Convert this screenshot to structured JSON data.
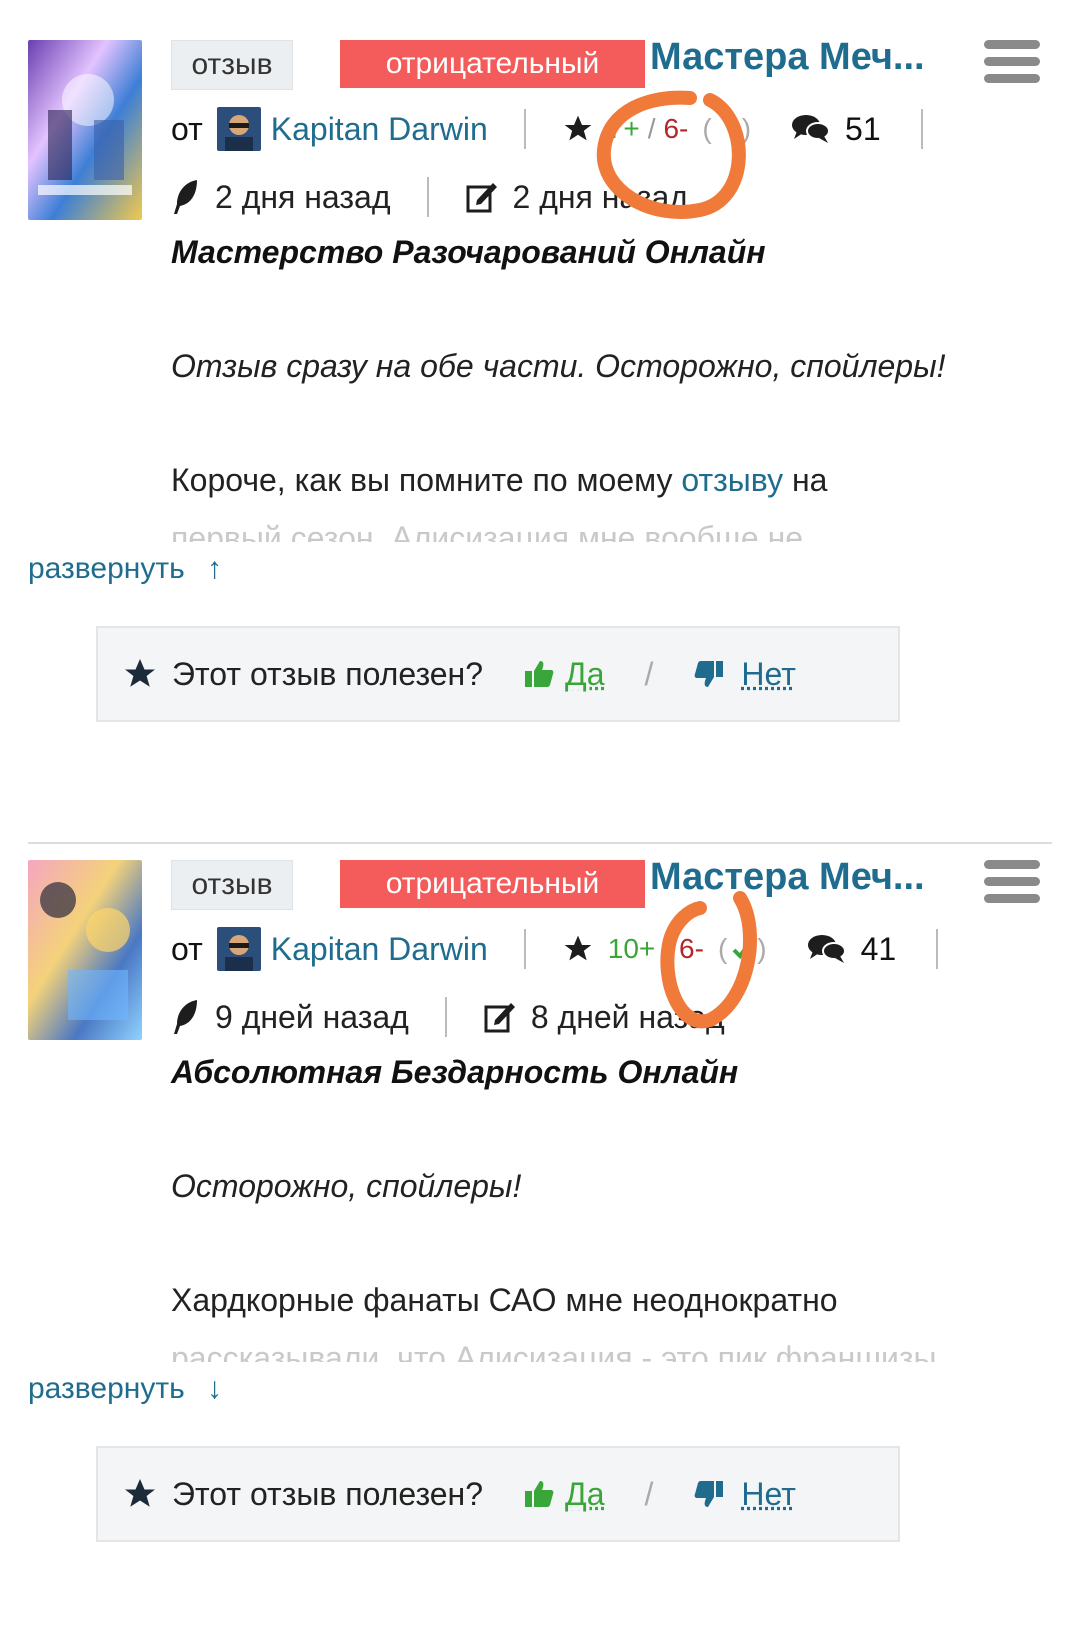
{
  "reviews": [
    {
      "type_label": "отзыв",
      "sentiment_label": "отрицательный",
      "anime_title": "Мастера Меч...",
      "by_label": "от",
      "author": "Kapitan Darwin",
      "rating_plus": "7+",
      "rating_minus": "6-",
      "rating_extra_open": "(",
      "rating_extra_close": ")",
      "comments": "51",
      "posted": "2 дня назад",
      "edited": "2 дня назад",
      "heading": "Мастерство Разочарований Онлайн",
      "intro": "Отзыв сразу на обе части. Осторожно, спойлеры!",
      "text_before_link": "Короче, как вы помните по моему ",
      "text_link": "отзыву",
      "text_after_link": " на",
      "faded_line": "первый сезон, Алисизация мне вообще не",
      "expand_label": "развернуть",
      "expand_arrow": "↑",
      "helpful_question": "Этот отзыв полезен?",
      "yes_label": "Да",
      "separator": "/",
      "no_label": "Нет"
    },
    {
      "type_label": "отзыв",
      "sentiment_label": "отрицательный",
      "anime_title": "Мастера Меч...",
      "by_label": "от",
      "author": "Kapitan Darwin",
      "rating_plus": "10+",
      "rating_minus": "6-",
      "rating_extra_open": "(",
      "rating_extra_close": ")",
      "comments": "41",
      "posted": "9 дней назад",
      "edited": "8 дней назад",
      "heading": "Абсолютная Бездарность Онлайн",
      "intro": "Осторожно, спойлеры!",
      "text_before_link": "Хардкорные фанаты САО мне неоднократно",
      "text_link": "",
      "text_after_link": "",
      "faded_line": "рассказывали, что Алисизация - это пик франшизы",
      "expand_label": "развернуть",
      "expand_arrow": "↓",
      "helpful_question": "Этот отзыв полезен?",
      "yes_label": "Да",
      "separator": "/",
      "no_label": "Нет"
    }
  ],
  "colors": {
    "accent": "#1f6c8f",
    "negative_tag": "#f45b5b",
    "plus": "#3aa63a",
    "minus": "#b02a2a",
    "annotation": "#f07a3a"
  }
}
